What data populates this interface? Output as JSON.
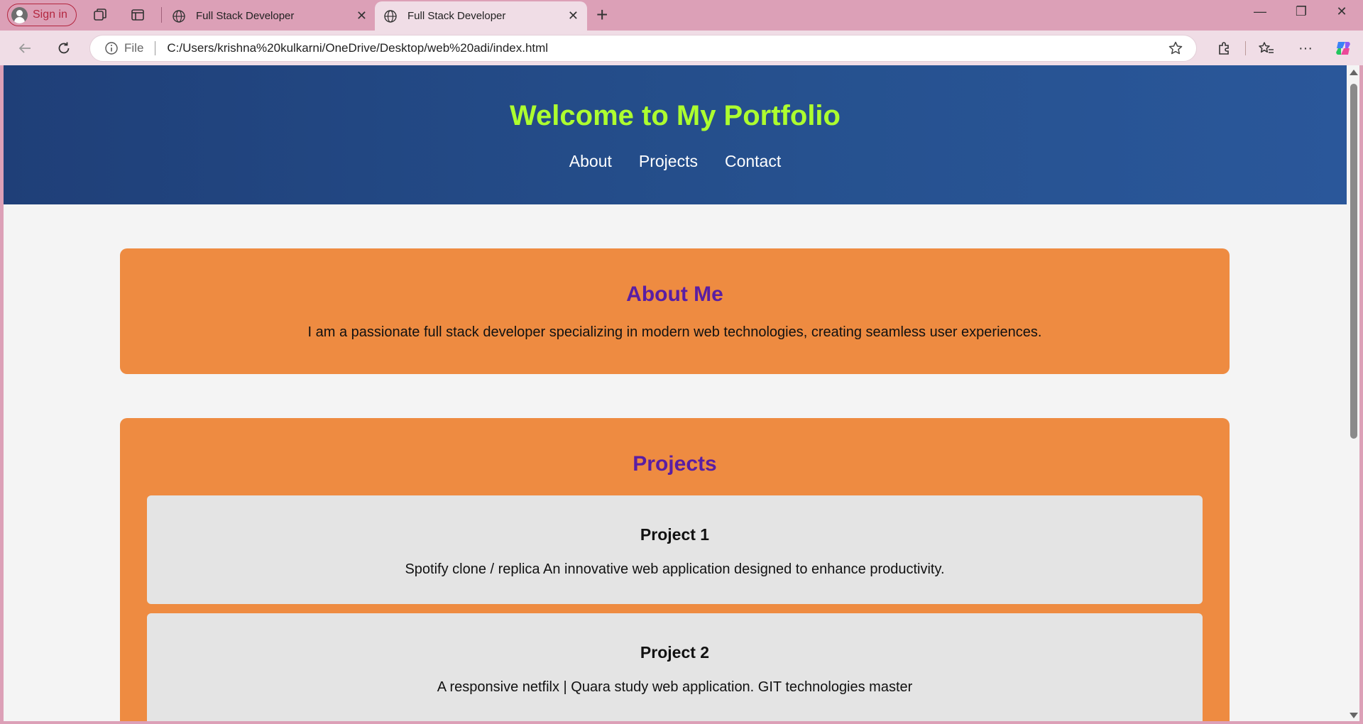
{
  "browser": {
    "signin_label": "Sign in",
    "tabs": [
      {
        "title": "Full Stack Developer",
        "active": false
      },
      {
        "title": "Full Stack Developer",
        "active": true
      }
    ],
    "address": {
      "scheme_label": "File",
      "url": "C:/Users/krishna%20kulkarni/OneDrive/Desktop/web%20adi/index.html"
    },
    "icons": [
      "workspaces-icon",
      "tab-actions-icon",
      "globe-icon",
      "close-icon",
      "new-tab-icon",
      "minimize-icon",
      "restore-icon",
      "window-close-icon",
      "back-icon",
      "refresh-icon",
      "info-icon",
      "favorite-star-icon",
      "extensions-icon",
      "favorites-icon",
      "more-icon",
      "copilot-icon"
    ]
  },
  "page": {
    "header": {
      "title": "Welcome to My Portfolio",
      "nav": [
        "About",
        "Projects",
        "Contact"
      ]
    },
    "about": {
      "heading": "About Me",
      "text": "I am a passionate full stack developer specializing in modern web technologies, creating seamless user experiences."
    },
    "projects": {
      "heading": "Projects",
      "items": [
        {
          "title": "Project 1",
          "description": "Spotify clone / replica An innovative web application designed to enhance productivity."
        },
        {
          "title": "Project 2",
          "description": "A responsive netfilx | Quara study web application. GIT technologies master"
        }
      ]
    }
  },
  "colors": {
    "header_bg": "#1f3f78",
    "title_color": "#adff2f",
    "section_bg": "#ee8b41",
    "heading_color": "#5a1ea3",
    "card_bg": "#e4e4e4",
    "chrome_bg": "#dca0b7"
  }
}
